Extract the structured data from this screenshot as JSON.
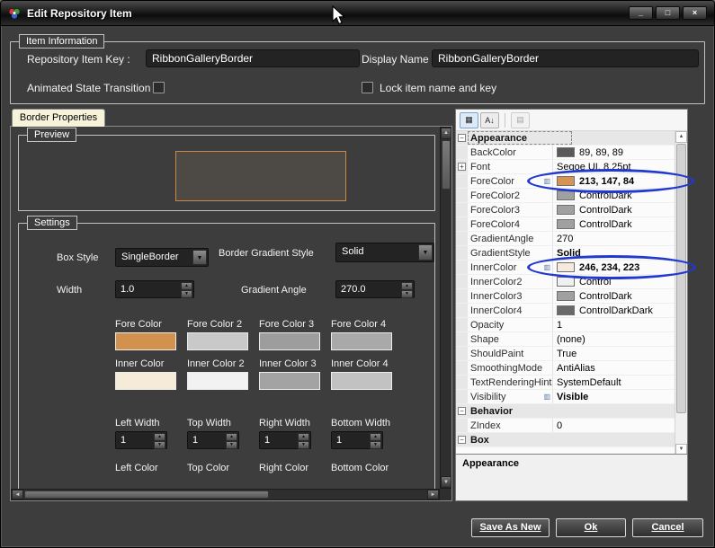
{
  "window": {
    "title": "Edit Repository Item",
    "controls": {
      "minimize": "_",
      "maximize": "□",
      "close": "×"
    }
  },
  "item_information": {
    "legend": "Item Information",
    "fields": [
      {
        "label": "Repository Item Key :",
        "value": "RibbonGalleryBorder"
      },
      {
        "label": "Display Name :",
        "value": "RibbonGalleryBorder"
      }
    ],
    "checkboxes": [
      {
        "label": "Animated State Transition",
        "checked": false
      },
      {
        "label": "Lock item name and key",
        "checked": false
      }
    ]
  },
  "tabs": [
    {
      "label": "Border Properties"
    }
  ],
  "preview": {
    "legend": "Preview",
    "border_color": "#cf8747"
  },
  "settings": {
    "legend": "Settings",
    "box_style": {
      "label": "Box Style",
      "value": "SingleBorder"
    },
    "border_gradient_style": {
      "label": "Border Gradient Style",
      "value": "Solid"
    },
    "width": {
      "label": "Width",
      "value": "1.0"
    },
    "gradient_angle": {
      "label": "Gradient Angle",
      "value": "270.0"
    },
    "fore_colors": [
      {
        "label": "Fore Color",
        "color": "#d2914d"
      },
      {
        "label": "Fore Color 2",
        "color": "#c9c9c9"
      },
      {
        "label": "Fore Color 3",
        "color": "#9d9d9d"
      },
      {
        "label": "Fore Color 4",
        "color": "#a9a9a9"
      }
    ],
    "inner_colors": [
      {
        "label": "Inner Color",
        "color": "#f6ead9"
      },
      {
        "label": "Inner Color 2",
        "color": "#f2f2f2"
      },
      {
        "label": "Inner Color 3",
        "color": "#a3a3a3"
      },
      {
        "label": "Inner Color 4",
        "color": "#c2c2c2"
      }
    ],
    "side_widths": [
      {
        "label": "Left Width",
        "value": "1"
      },
      {
        "label": "Top Width",
        "value": "1"
      },
      {
        "label": "Right Width",
        "value": "1"
      },
      {
        "label": "Bottom Width",
        "value": "1"
      }
    ],
    "side_color_labels": [
      "Left Color",
      "Top Color",
      "Right Color",
      "Bottom Color"
    ]
  },
  "property_grid": {
    "toolbar": {
      "categorized_icon": "▦",
      "alphabetical_icon": "A↓",
      "property_pages_icon": "▤"
    },
    "rows": [
      {
        "type": "category",
        "name": "Appearance",
        "focus": true
      },
      {
        "type": "prop",
        "name": "BackColor",
        "value": "89, 89, 89",
        "swatch": "#595959"
      },
      {
        "type": "prop",
        "name": "Font",
        "value": "Segoe UI, 8.25pt",
        "expand": true
      },
      {
        "type": "prop",
        "name": "ForeColor",
        "value": "213, 147, 84",
        "swatch": "#d59354",
        "bold": true,
        "flag": true
      },
      {
        "type": "prop",
        "name": "ForeColor2",
        "value": "ControlDark",
        "swatch": "#a0a0a0"
      },
      {
        "type": "prop",
        "name": "ForeColor3",
        "value": "ControlDark",
        "swatch": "#a0a0a0"
      },
      {
        "type": "prop",
        "name": "ForeColor4",
        "value": "ControlDark",
        "swatch": "#a0a0a0"
      },
      {
        "type": "prop",
        "name": "GradientAngle",
        "value": "270"
      },
      {
        "type": "prop",
        "name": "GradientStyle",
        "value": "Solid",
        "bold": true
      },
      {
        "type": "prop",
        "name": "InnerColor",
        "value": "246, 234, 223",
        "swatch": "#f6eadf",
        "bold": true,
        "flag": true
      },
      {
        "type": "prop",
        "name": "InnerColor2",
        "value": "Control",
        "swatch": "#f0f0f0"
      },
      {
        "type": "prop",
        "name": "InnerColor3",
        "value": "ControlDark",
        "swatch": "#a0a0a0"
      },
      {
        "type": "prop",
        "name": "InnerColor4",
        "value": "ControlDarkDark",
        "swatch": "#696969"
      },
      {
        "type": "prop",
        "name": "Opacity",
        "value": "1"
      },
      {
        "type": "prop",
        "name": "Shape",
        "value": "(none)"
      },
      {
        "type": "prop",
        "name": "ShouldPaint",
        "value": "True"
      },
      {
        "type": "prop",
        "name": "SmoothingMode",
        "value": "AntiAlias"
      },
      {
        "type": "prop",
        "name": "TextRenderingHint",
        "value": "SystemDefault"
      },
      {
        "type": "prop",
        "name": "Visibility",
        "value": "Visible",
        "bold": true,
        "flag": true
      },
      {
        "type": "category",
        "name": "Behavior"
      },
      {
        "type": "prop",
        "name": "ZIndex",
        "value": "0"
      },
      {
        "type": "category",
        "name": "Box"
      }
    ],
    "description_title": "Appearance"
  },
  "footer_buttons": [
    {
      "label": "Save As New"
    },
    {
      "label": "Ok"
    },
    {
      "label": "Cancel"
    }
  ],
  "annotations": {
    "highlight_color": "#2239cf",
    "highlighted_properties": [
      "ForeColor",
      "InnerColor"
    ]
  }
}
